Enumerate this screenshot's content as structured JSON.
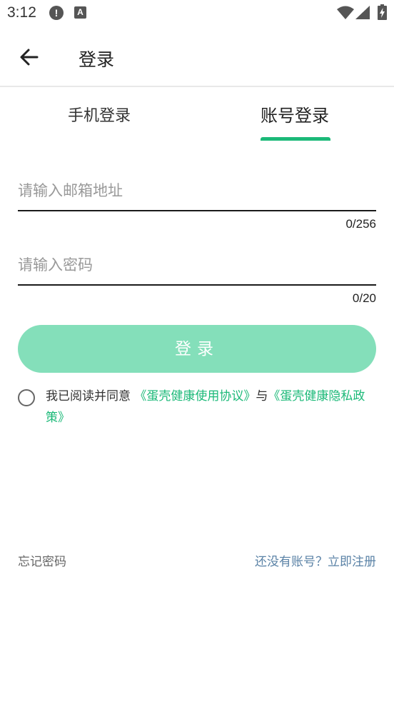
{
  "status_bar": {
    "time": "3:12",
    "alert_icon": "!",
    "a_icon": "A"
  },
  "header": {
    "title": "登录"
  },
  "tabs": [
    {
      "label": "手机登录",
      "active": false
    },
    {
      "label": "账号登录",
      "active": true
    }
  ],
  "form": {
    "email_placeholder": "请输入邮箱地址",
    "email_value": "",
    "email_counter": "0/256",
    "password_placeholder": "请输入密码",
    "password_value": "",
    "password_counter": "0/20",
    "login_label": "登录"
  },
  "agreement": {
    "prefix": "我已阅读并同意",
    "link1": "《蛋壳健康使用协议》",
    "middle": "与",
    "link2": "《蛋壳健康隐私政策》"
  },
  "footer": {
    "forgot_password": "忘记密码",
    "register": "还没有账号？立即注册"
  },
  "colors": {
    "accent": "#1bb978",
    "button_disabled": "#84dfba",
    "link_blue": "#5a82a6"
  }
}
